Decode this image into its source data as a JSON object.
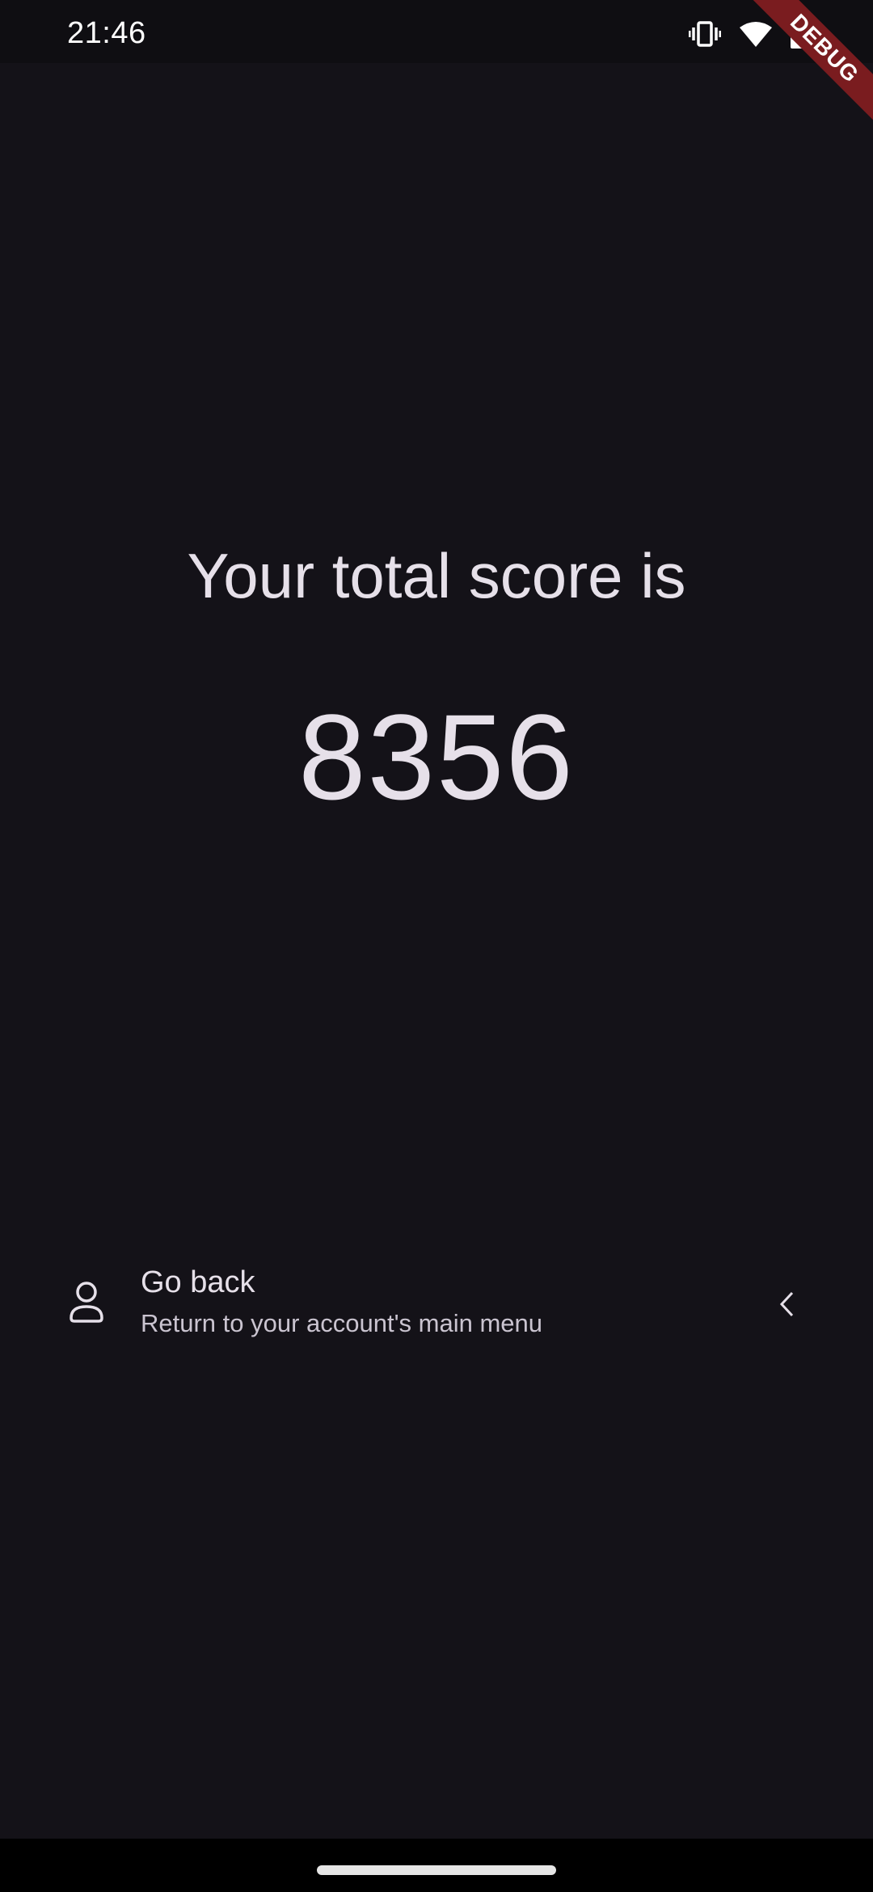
{
  "status_bar": {
    "time": "21:46",
    "icons": [
      "vibrate-icon",
      "wifi-icon",
      "battery-charging-icon"
    ]
  },
  "debug_banner": {
    "label": "DEBUG",
    "color": "#7A1C1F"
  },
  "score": {
    "title": "Your total score is",
    "value": "8356"
  },
  "go_back": {
    "title": "Go back",
    "subtitle": "Return to your account's main menu",
    "leading_icon": "person-icon",
    "trailing_icon": "chevron-left-icon"
  },
  "theme": {
    "background": "#141218",
    "status_bar_background": "#0F0E12",
    "text_primary": "#E6E0E9",
    "text_secondary": "#CAC4D0"
  }
}
